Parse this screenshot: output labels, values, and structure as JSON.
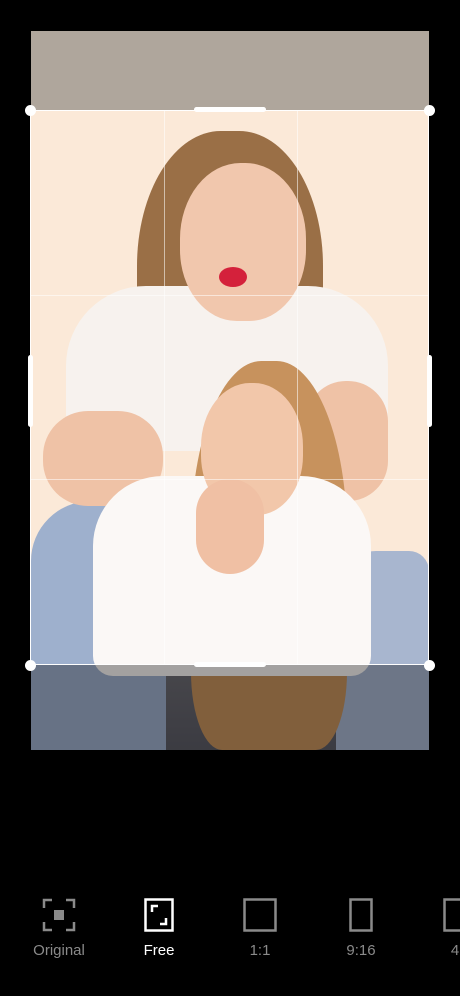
{
  "toolbar": {
    "items": [
      {
        "label": "Original",
        "icon": "focus-frame-icon",
        "active": false
      },
      {
        "label": "Free",
        "icon": "free-crop-icon",
        "active": true
      },
      {
        "label": "1:1",
        "icon": "square-ratio-icon",
        "active": false
      },
      {
        "label": "9:16",
        "icon": "portrait-ratio-icon",
        "active": false
      },
      {
        "label": "4",
        "icon": "ratio-icon",
        "active": false
      }
    ]
  },
  "colors": {
    "background": "#000000",
    "active_label": "#ffffff",
    "inactive_label": "#8a8a8a",
    "photo_backdrop": "#fbe9d8"
  }
}
